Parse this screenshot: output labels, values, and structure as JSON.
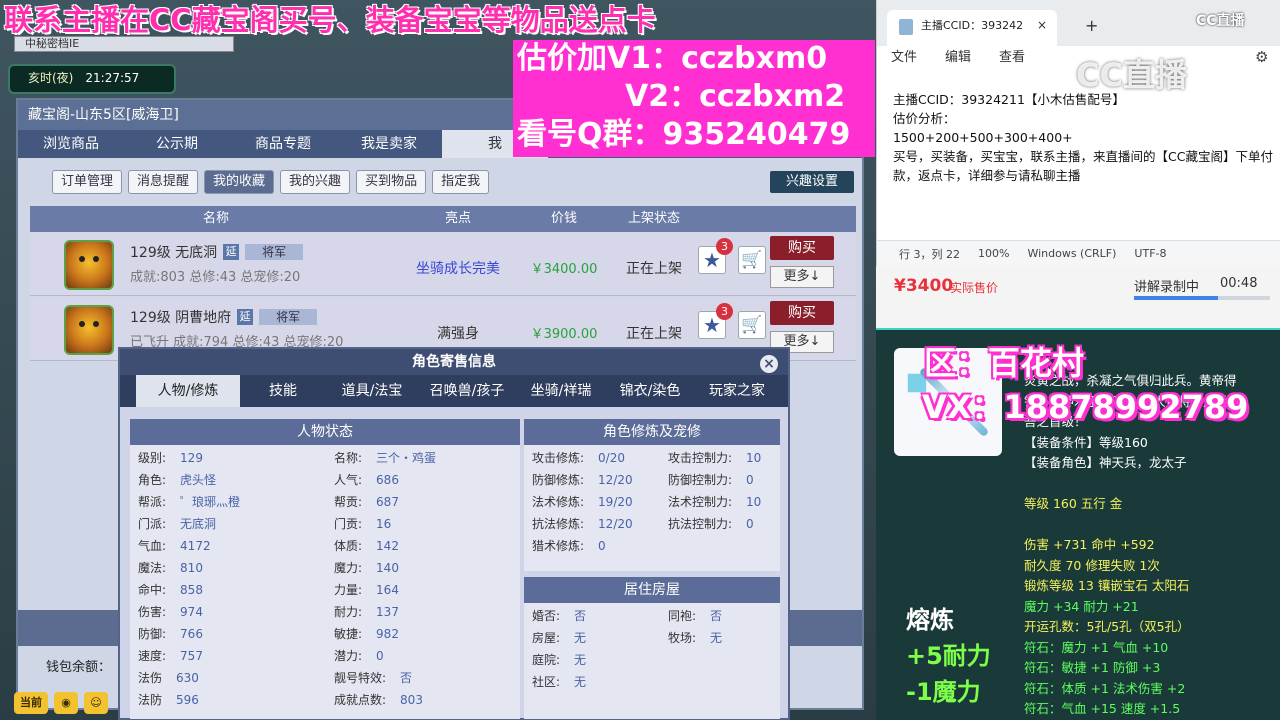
{
  "banner": {
    "line1": "联系主播在CC藏宝阁买号、装备宝宝等物品送点卡",
    "v1": "估价加V1：cczbxm0",
    "v2": "V2：cczbxm2",
    "qq": "看号Q群：935240479"
  },
  "game": {
    "tab_title": "中秘密档IE",
    "clock_label": "亥时(夜)",
    "clock_time": "21:27:57",
    "wallet_label": "钱包余额："
  },
  "window": {
    "title": "藏宝阁-山东5区[威海卫]",
    "nav_tabs": [
      "浏览商品",
      "公示期",
      "商品专题",
      "我是卖家",
      "我"
    ],
    "sub_tabs": [
      "订单管理",
      "消息提醒",
      "我的收藏",
      "我的兴趣",
      "买到物品",
      "指定我"
    ],
    "interest_settings": "兴趣设置",
    "columns": [
      "名称",
      "亮点",
      "价钱",
      "上架状态"
    ],
    "rows": [
      {
        "name": "129级 无底洞",
        "tag1": "延",
        "tag2": "将军",
        "stats": "成就:803 总修:43 总宠修:20",
        "highlight": "坐骑成长完美",
        "price": "￥3400.00",
        "status": "正在上架",
        "badge": "3",
        "buy": "购买",
        "more": "更多↓"
      },
      {
        "name": "129级 阴曹地府",
        "tag1": "延",
        "tag2": "将军",
        "stats": "已飞升 成就:794 总修:43 总宠修:20",
        "highlight": "满强身",
        "price": "￥3900.00",
        "status": "正在上架",
        "badge": "3",
        "buy": "购买",
        "more": "更多↓"
      }
    ]
  },
  "bottom": {
    "current": "当前"
  },
  "popup": {
    "title": "角色寄售信息",
    "close": "×",
    "tabs": [
      "人物/修炼",
      "技能",
      "道具/法宝",
      "召唤兽/孩子",
      "坐骑/祥瑞",
      "锦衣/染色",
      "玩家之家"
    ],
    "status_head": "人物状态",
    "left_col": [
      [
        "级别:",
        "129"
      ],
      [
        "角色:",
        "虎头怪"
      ],
      [
        "帮派:",
        "゜琅琊灬橙"
      ],
      [
        "门派:",
        "无底洞"
      ],
      [
        "气血:",
        "4172"
      ],
      [
        "魔法:",
        "810"
      ],
      [
        "命中:",
        "858"
      ],
      [
        "伤害:",
        "974"
      ],
      [
        "防御:",
        "766"
      ],
      [
        "速度:",
        "757"
      ],
      [
        "法伤",
        "630"
      ],
      [
        "法防",
        "596"
      ]
    ],
    "mid_col": [
      [
        "名称:",
        "三个・鸡蛋"
      ],
      [
        "人气:",
        "686"
      ],
      [
        "帮贡:",
        "687"
      ],
      [
        "门贡:",
        "16"
      ],
      [
        "体质:",
        "142"
      ],
      [
        "魔力:",
        "140"
      ],
      [
        "力量:",
        "164"
      ],
      [
        "耐力:",
        "137"
      ],
      [
        "敏捷:",
        "982"
      ],
      [
        "潜力:",
        "0"
      ],
      [
        "靓号特效:",
        "否"
      ],
      [
        "成就点数:",
        "803"
      ]
    ],
    "cult_head": "角色修炼及宠修",
    "cult_left": [
      [
        "攻击修炼:",
        "0/20"
      ],
      [
        "防御修炼:",
        "12/20"
      ],
      [
        "法术修炼:",
        "19/20"
      ],
      [
        "抗法修炼:",
        "12/20"
      ],
      [
        "猎术修炼:",
        "0"
      ]
    ],
    "cult_right": [
      [
        "攻击控制力:",
        "10"
      ],
      [
        "防御控制力:",
        "0"
      ],
      [
        "法术控制力:",
        "10"
      ],
      [
        "抗法控制力:",
        "0"
      ]
    ],
    "house_head": "居住房屋",
    "house_left": [
      [
        "婚否:",
        "否"
      ],
      [
        "房屋:",
        "无"
      ],
      [
        "庭院:",
        "无"
      ],
      [
        "社区:",
        "无"
      ]
    ],
    "house_right": [
      [
        "同袍:",
        "否"
      ],
      [
        "牧场:",
        "无"
      ]
    ]
  },
  "notepad": {
    "tab_title": "主播CCID：393242",
    "close": "×",
    "plus": "+",
    "menu": [
      "文件",
      "编辑",
      "查看"
    ],
    "lines": [
      "主播CCID：39324211【小木估售配号】",
      "估价分析：",
      "1500+200+500+300+400+",
      "买号，买装备，买宝宝，联系主播，来直播间的【CC藏宝阁】下单付款，返点卡，详细参与请私聊主播"
    ],
    "status": [
      "行 3，列 22",
      "100%",
      "Windows (CRLF)",
      "UTF-8"
    ]
  },
  "logo": {
    "small": "CC直播",
    "big": "CC直播"
  },
  "pricebar": {
    "amount": "¥3400",
    "label": "实际售价",
    "rec": "讲解录制中",
    "time": "00:48",
    "progress": 0.62
  },
  "right": {
    "zone": "区：百花村",
    "vx": "VX：18878992789",
    "desc": [
      {
        "t": "炎黄之战，杀凝之气俱归此兵。黄帝得",
        "c": "w"
      },
      {
        "t": "钱，王神木于，则大 之人百将扔此兵者",
        "c": "w"
      },
      {
        "t": "吾之首级！",
        "c": "w"
      },
      {
        "t": "【装备条件】等级160",
        "c": "w"
      },
      {
        "t": "【装备角色】神天兵，龙太子",
        "c": "w"
      },
      {
        "t": "",
        "c": "w"
      },
      {
        "t": "等级 160 五行 金",
        "c": "y"
      },
      {
        "t": "",
        "c": "w"
      },
      {
        "t": "伤害 +731 命中 +592",
        "c": "y"
      },
      {
        "t": "耐久度 70 修理失败 1次",
        "c": "y"
      },
      {
        "t": "锻炼等级 13 镶嵌宝石 太阳石",
        "c": "y"
      },
      {
        "t": "魔力 +34 耐力 +21",
        "c": "g"
      },
      {
        "t": "开运孔数：5孔/5孔（双5孔）",
        "c": "y"
      },
      {
        "t": "符石：魔力 +1 气血 +10",
        "c": "g"
      },
      {
        "t": "符石：敏捷 +1 防御 +3",
        "c": "g"
      },
      {
        "t": "符石：体质 +1 法术伤害 +2",
        "c": "g"
      },
      {
        "t": "符石：气血 +15 速度 +1.5",
        "c": "g"
      }
    ],
    "refine_title": "熔炼",
    "refine1": "+5耐力",
    "refine2": "-1魔力"
  }
}
